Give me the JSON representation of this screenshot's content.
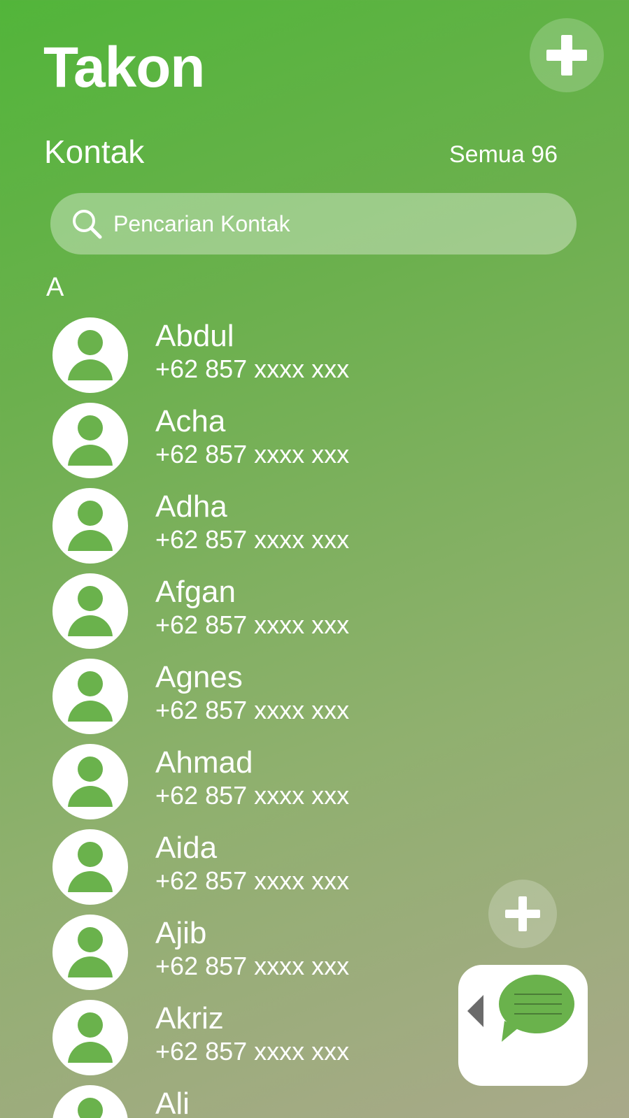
{
  "header": {
    "app_title": "Takon",
    "add_icon": "plus-icon"
  },
  "contacts_header": {
    "title": "Kontak",
    "count_label": "Semua 96"
  },
  "search": {
    "placeholder": "Pencarian Kontak",
    "value": "",
    "icon": "search-icon"
  },
  "section_letter": "A",
  "contacts": [
    {
      "name": "Abdul",
      "phone": "+62 857 xxxx xxx"
    },
    {
      "name": "Acha",
      "phone": "+62 857 xxxx xxx"
    },
    {
      "name": "Adha",
      "phone": "+62 857 xxxx xxx"
    },
    {
      "name": "Afgan",
      "phone": "+62 857 xxxx xxx"
    },
    {
      "name": "Agnes",
      "phone": "+62 857 xxxx xxx"
    },
    {
      "name": "Ahmad",
      "phone": "+62 857 xxxx xxx"
    },
    {
      "name": "Aida",
      "phone": "+62 857 xxxx xxx"
    },
    {
      "name": "Ajib",
      "phone": "+62 857 xxxx xxx"
    },
    {
      "name": "Akriz",
      "phone": "+62 857 xxxx xxx"
    },
    {
      "name": "Ali",
      "phone": ""
    }
  ],
  "floating": {
    "add_icon": "plus-icon",
    "chat_icon": "chat-bubble-icon",
    "collapse_icon": "triangle-left-icon"
  },
  "colors": {
    "accent": "#6ab24c",
    "background_top": "#52b53a",
    "background_bottom": "#a9a98a"
  }
}
